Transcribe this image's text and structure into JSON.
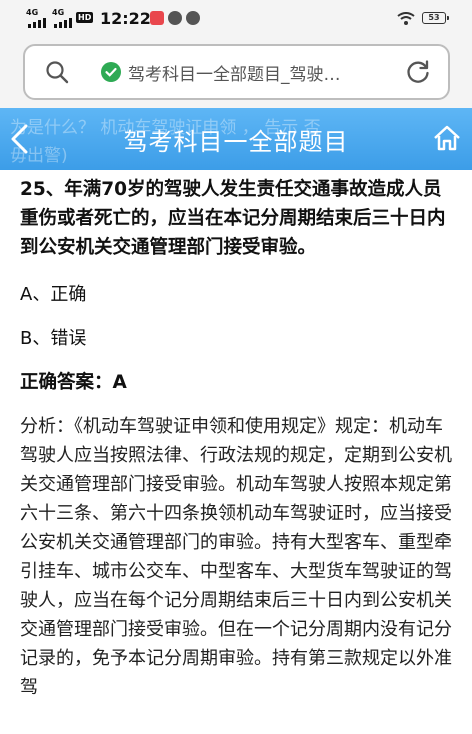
{
  "status_bar": {
    "net1": "4G",
    "net2": "4G",
    "hd": "HD",
    "time": "12:22",
    "battery": "53"
  },
  "address_bar": {
    "url_text": "驾考科目一全部题目_驾驶…"
  },
  "header": {
    "title": "驾考科目一全部题目",
    "ghost_text": "为是什么？      机动车驾驶证申领       ，     告示  否",
    "ghost_text2": "毋出警)"
  },
  "question": {
    "text": "25、年满70岁的驾驶人发生责任交通事故造成人员重伤或者死亡的，应当在本记分周期结束后三十日内到公安机关交通管理部门接受审验。"
  },
  "options": [
    {
      "label": "A、正确"
    },
    {
      "label": "B、错误"
    }
  ],
  "answer": {
    "text": "正确答案：A"
  },
  "analysis": {
    "text": "分析：《机动车驾驶证申领和使用规定》规定：机动车驾驶人应当按照法律、行政法规的规定，定期到公安机关交通管理部门接受审验。机动车驾驶人按照本规定第六十三条、第六十四条换领机动车驾驶证时，应当接受公安机关交通管理部门的审验。持有大型客车、重型牵引挂车、城市公交车、中型客车、大型货车驾驶证的驾驶人，应当在每个记分周期结束后三十日内到公安机关交通管理部门接受审验。但在一个记分周期内没有记分记录的，免予本记分周期审验。持有第三款规定以外准驾"
  },
  "colors": {
    "header_blue": "#3c9de8",
    "shield_green": "#2eaa54"
  }
}
